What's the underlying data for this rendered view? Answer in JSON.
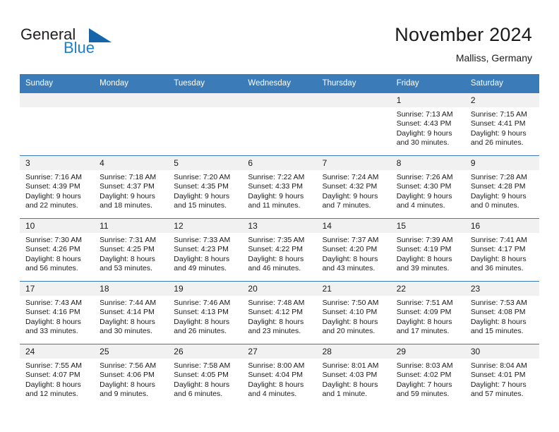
{
  "brand": {
    "name_part1": "General",
    "name_part2": "Blue",
    "triangle_icon": "triangle-icon",
    "color_dark": "#231f20",
    "color_blue": "#1e7fc4"
  },
  "header": {
    "title": "November 2024",
    "subtitle": "Malliss, Germany"
  },
  "theme": {
    "header_blue": "#3b7cb8",
    "daynum_band": "#f1f1f1",
    "text": "#1a1a1a"
  },
  "weekdays": [
    "Sunday",
    "Monday",
    "Tuesday",
    "Wednesday",
    "Thursday",
    "Friday",
    "Saturday"
  ],
  "weeks": [
    [
      {
        "day": "",
        "sunrise": "",
        "sunset": "",
        "daylight1": "",
        "daylight2": ""
      },
      {
        "day": "",
        "sunrise": "",
        "sunset": "",
        "daylight1": "",
        "daylight2": ""
      },
      {
        "day": "",
        "sunrise": "",
        "sunset": "",
        "daylight1": "",
        "daylight2": ""
      },
      {
        "day": "",
        "sunrise": "",
        "sunset": "",
        "daylight1": "",
        "daylight2": ""
      },
      {
        "day": "",
        "sunrise": "",
        "sunset": "",
        "daylight1": "",
        "daylight2": ""
      },
      {
        "day": "1",
        "sunrise": "Sunrise: 7:13 AM",
        "sunset": "Sunset: 4:43 PM",
        "daylight1": "Daylight: 9 hours",
        "daylight2": "and 30 minutes."
      },
      {
        "day": "2",
        "sunrise": "Sunrise: 7:15 AM",
        "sunset": "Sunset: 4:41 PM",
        "daylight1": "Daylight: 9 hours",
        "daylight2": "and 26 minutes."
      }
    ],
    [
      {
        "day": "3",
        "sunrise": "Sunrise: 7:16 AM",
        "sunset": "Sunset: 4:39 PM",
        "daylight1": "Daylight: 9 hours",
        "daylight2": "and 22 minutes."
      },
      {
        "day": "4",
        "sunrise": "Sunrise: 7:18 AM",
        "sunset": "Sunset: 4:37 PM",
        "daylight1": "Daylight: 9 hours",
        "daylight2": "and 18 minutes."
      },
      {
        "day": "5",
        "sunrise": "Sunrise: 7:20 AM",
        "sunset": "Sunset: 4:35 PM",
        "daylight1": "Daylight: 9 hours",
        "daylight2": "and 15 minutes."
      },
      {
        "day": "6",
        "sunrise": "Sunrise: 7:22 AM",
        "sunset": "Sunset: 4:33 PM",
        "daylight1": "Daylight: 9 hours",
        "daylight2": "and 11 minutes."
      },
      {
        "day": "7",
        "sunrise": "Sunrise: 7:24 AM",
        "sunset": "Sunset: 4:32 PM",
        "daylight1": "Daylight: 9 hours",
        "daylight2": "and 7 minutes."
      },
      {
        "day": "8",
        "sunrise": "Sunrise: 7:26 AM",
        "sunset": "Sunset: 4:30 PM",
        "daylight1": "Daylight: 9 hours",
        "daylight2": "and 4 minutes."
      },
      {
        "day": "9",
        "sunrise": "Sunrise: 7:28 AM",
        "sunset": "Sunset: 4:28 PM",
        "daylight1": "Daylight: 9 hours",
        "daylight2": "and 0 minutes."
      }
    ],
    [
      {
        "day": "10",
        "sunrise": "Sunrise: 7:30 AM",
        "sunset": "Sunset: 4:26 PM",
        "daylight1": "Daylight: 8 hours",
        "daylight2": "and 56 minutes."
      },
      {
        "day": "11",
        "sunrise": "Sunrise: 7:31 AM",
        "sunset": "Sunset: 4:25 PM",
        "daylight1": "Daylight: 8 hours",
        "daylight2": "and 53 minutes."
      },
      {
        "day": "12",
        "sunrise": "Sunrise: 7:33 AM",
        "sunset": "Sunset: 4:23 PM",
        "daylight1": "Daylight: 8 hours",
        "daylight2": "and 49 minutes."
      },
      {
        "day": "13",
        "sunrise": "Sunrise: 7:35 AM",
        "sunset": "Sunset: 4:22 PM",
        "daylight1": "Daylight: 8 hours",
        "daylight2": "and 46 minutes."
      },
      {
        "day": "14",
        "sunrise": "Sunrise: 7:37 AM",
        "sunset": "Sunset: 4:20 PM",
        "daylight1": "Daylight: 8 hours",
        "daylight2": "and 43 minutes."
      },
      {
        "day": "15",
        "sunrise": "Sunrise: 7:39 AM",
        "sunset": "Sunset: 4:19 PM",
        "daylight1": "Daylight: 8 hours",
        "daylight2": "and 39 minutes."
      },
      {
        "day": "16",
        "sunrise": "Sunrise: 7:41 AM",
        "sunset": "Sunset: 4:17 PM",
        "daylight1": "Daylight: 8 hours",
        "daylight2": "and 36 minutes."
      }
    ],
    [
      {
        "day": "17",
        "sunrise": "Sunrise: 7:43 AM",
        "sunset": "Sunset: 4:16 PM",
        "daylight1": "Daylight: 8 hours",
        "daylight2": "and 33 minutes."
      },
      {
        "day": "18",
        "sunrise": "Sunrise: 7:44 AM",
        "sunset": "Sunset: 4:14 PM",
        "daylight1": "Daylight: 8 hours",
        "daylight2": "and 30 minutes."
      },
      {
        "day": "19",
        "sunrise": "Sunrise: 7:46 AM",
        "sunset": "Sunset: 4:13 PM",
        "daylight1": "Daylight: 8 hours",
        "daylight2": "and 26 minutes."
      },
      {
        "day": "20",
        "sunrise": "Sunrise: 7:48 AM",
        "sunset": "Sunset: 4:12 PM",
        "daylight1": "Daylight: 8 hours",
        "daylight2": "and 23 minutes."
      },
      {
        "day": "21",
        "sunrise": "Sunrise: 7:50 AM",
        "sunset": "Sunset: 4:10 PM",
        "daylight1": "Daylight: 8 hours",
        "daylight2": "and 20 minutes."
      },
      {
        "day": "22",
        "sunrise": "Sunrise: 7:51 AM",
        "sunset": "Sunset: 4:09 PM",
        "daylight1": "Daylight: 8 hours",
        "daylight2": "and 17 minutes."
      },
      {
        "day": "23",
        "sunrise": "Sunrise: 7:53 AM",
        "sunset": "Sunset: 4:08 PM",
        "daylight1": "Daylight: 8 hours",
        "daylight2": "and 15 minutes."
      }
    ],
    [
      {
        "day": "24",
        "sunrise": "Sunrise: 7:55 AM",
        "sunset": "Sunset: 4:07 PM",
        "daylight1": "Daylight: 8 hours",
        "daylight2": "and 12 minutes."
      },
      {
        "day": "25",
        "sunrise": "Sunrise: 7:56 AM",
        "sunset": "Sunset: 4:06 PM",
        "daylight1": "Daylight: 8 hours",
        "daylight2": "and 9 minutes."
      },
      {
        "day": "26",
        "sunrise": "Sunrise: 7:58 AM",
        "sunset": "Sunset: 4:05 PM",
        "daylight1": "Daylight: 8 hours",
        "daylight2": "and 6 minutes."
      },
      {
        "day": "27",
        "sunrise": "Sunrise: 8:00 AM",
        "sunset": "Sunset: 4:04 PM",
        "daylight1": "Daylight: 8 hours",
        "daylight2": "and 4 minutes."
      },
      {
        "day": "28",
        "sunrise": "Sunrise: 8:01 AM",
        "sunset": "Sunset: 4:03 PM",
        "daylight1": "Daylight: 8 hours",
        "daylight2": "and 1 minute."
      },
      {
        "day": "29",
        "sunrise": "Sunrise: 8:03 AM",
        "sunset": "Sunset: 4:02 PM",
        "daylight1": "Daylight: 7 hours",
        "daylight2": "and 59 minutes."
      },
      {
        "day": "30",
        "sunrise": "Sunrise: 8:04 AM",
        "sunset": "Sunset: 4:01 PM",
        "daylight1": "Daylight: 7 hours",
        "daylight2": "and 57 minutes."
      }
    ]
  ]
}
